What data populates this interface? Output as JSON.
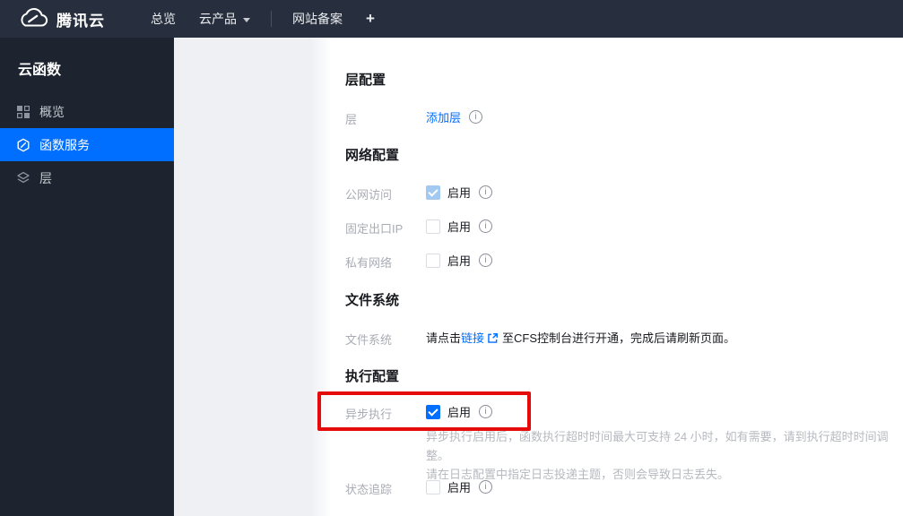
{
  "topbar": {
    "brand": "腾讯云",
    "nav_overview": "总览",
    "nav_products": "云产品",
    "nav_icp": "网站备案",
    "nav_plus": "+"
  },
  "sidebar": {
    "title": "云函数",
    "items": [
      {
        "label": "概览",
        "icon": "grid-icon",
        "active": false
      },
      {
        "label": "函数服务",
        "icon": "function-icon",
        "active": true
      },
      {
        "label": "层",
        "icon": "layers-icon",
        "active": false
      }
    ]
  },
  "content": {
    "layer_section": {
      "heading": "层配置",
      "label": "层",
      "add_layer_link": "添加层"
    },
    "network_section": {
      "heading": "网络配置",
      "rows": [
        {
          "label": "公网访问",
          "enable_label": "启用",
          "checked": true,
          "disabled": true
        },
        {
          "label": "固定出口IP",
          "enable_label": "启用",
          "checked": false,
          "disabled": false
        },
        {
          "label": "私有网络",
          "enable_label": "启用",
          "checked": false,
          "disabled": false
        }
      ]
    },
    "filesystem_section": {
      "heading": "文件系统",
      "label": "文件系统",
      "text_before": "请点击",
      "link_text": "链接",
      "text_after": "至CFS控制台进行开通，完成后请刷新页面。"
    },
    "execution_section": {
      "heading": "执行配置",
      "async_row": {
        "label": "异步执行",
        "enable_label": "启用",
        "checked": true,
        "disabled": false
      },
      "async_hint_line1": "异步执行启用后，函数执行超时时间最大可支持 24 小时，如有需要，请到执行超时时间调整。",
      "async_hint_line2": "请在日志配置中指定日志投递主题，否则会导致日志丢失。",
      "status_row": {
        "label": "状态追踪",
        "enable_label": "启用",
        "checked": false,
        "disabled": false
      }
    }
  },
  "colors": {
    "accent_blue": "#006EFF",
    "topbar_bg": "#272F3E",
    "sidebar_bg": "#1D2430",
    "gray_panel": "#EEF0F4",
    "highlight_red": "#E60B0B",
    "disabled_checked_checkbox": "#A2C9F1"
  }
}
